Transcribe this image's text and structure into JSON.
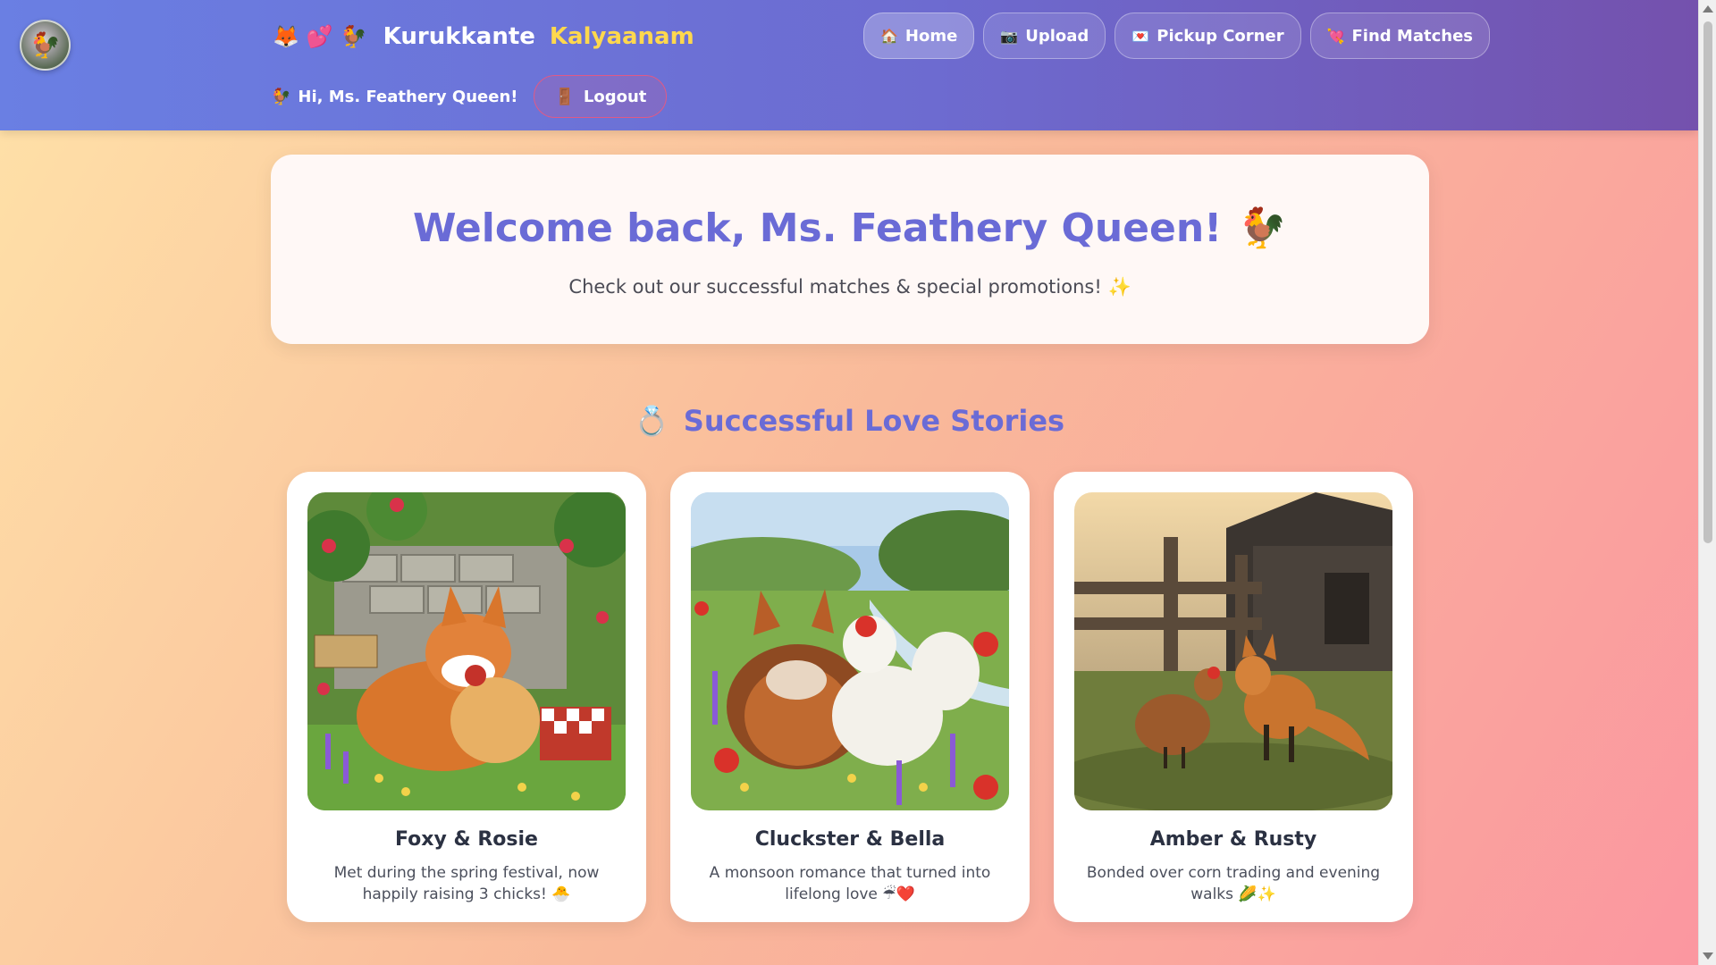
{
  "header": {
    "avatar_icon": "rooster-avatar",
    "brand_emojis": [
      "🦊",
      "💕",
      "🐓"
    ],
    "brand_title": "Kurukkante",
    "brand_accent": "Kalyaanam",
    "nav": [
      {
        "icon": "🏠",
        "label": "Home",
        "active": true
      },
      {
        "icon": "📷",
        "label": "Upload",
        "active": false
      },
      {
        "icon": "💌",
        "label": "Pickup Corner",
        "active": false
      },
      {
        "icon": "💘",
        "label": "Find Matches",
        "active": false
      }
    ],
    "greeting_icon": "🐓",
    "greeting": "Hi, Ms. Feathery Queen!",
    "logout_icon": "🚪",
    "logout_label": "Logout"
  },
  "welcome": {
    "title": "Welcome back, Ms. Feathery Queen!",
    "title_icon": "🐓",
    "subtitle": "Check out our successful matches & special promotions! ✨"
  },
  "stories": {
    "section_icon": "💍",
    "section_title": "Successful Love Stories",
    "items": [
      {
        "title": "Foxy & Rosie",
        "text": "Met during the spring festival, now happily raising 3 chicks! 🐣",
        "image": "fox-and-hen-picnic"
      },
      {
        "title": "Cluckster & Bella",
        "text": "A monsoon romance that turned into lifelong love ☔❤️",
        "image": "fox-and-hens-meadow"
      },
      {
        "title": "Amber & Rusty",
        "text": "Bonded over corn trading and evening walks 🌽✨",
        "image": "hen-and-fox-farm"
      }
    ]
  },
  "colors": {
    "header_start": "#6a7fe3",
    "header_end": "#7451ad",
    "accent": "#ffd84d",
    "title": "#6a6bd6",
    "logout_border": "#e05a86"
  }
}
